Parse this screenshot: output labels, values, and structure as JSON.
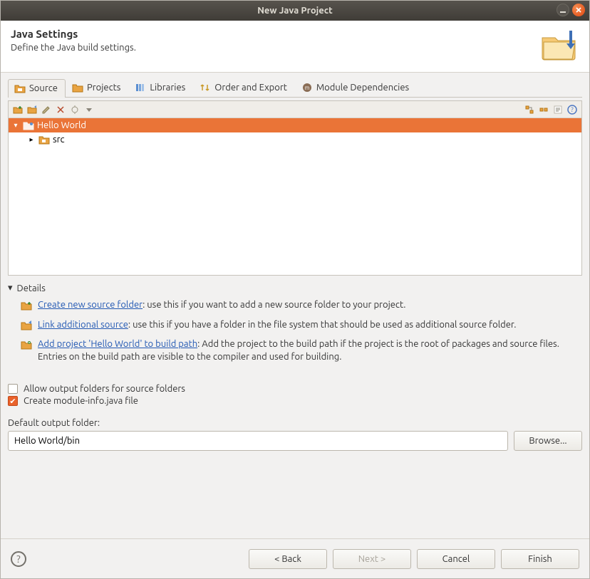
{
  "window": {
    "title": "New Java Project"
  },
  "header": {
    "title": "Java Settings",
    "subtitle": "Define the Java build settings."
  },
  "tabs": [
    {
      "label": "Source"
    },
    {
      "label": "Projects"
    },
    {
      "label": "Libraries"
    },
    {
      "label": "Order and Export"
    },
    {
      "label": "Module Dependencies"
    }
  ],
  "tree": {
    "root": "Hello World",
    "child": "src"
  },
  "details": {
    "heading": "Details",
    "items": [
      {
        "link": "Create new source folder",
        "tail": ": use this if you want to add a new source folder to your project."
      },
      {
        "link": "Link additional source",
        "tail": ": use this if you have a folder in the file system that should be used as additional source folder."
      },
      {
        "link": "Add project 'Hello World' to build path",
        "tail": ": Add the project to the build path if the project is the root of packages and source files. Entries on the build path are visible to the compiler and used for building."
      }
    ]
  },
  "checks": {
    "allow_output": {
      "label": "Allow output folders for source folders",
      "checked": false
    },
    "module_info": {
      "label": "Create module-info.java file",
      "checked": true
    }
  },
  "output": {
    "label": "Default output folder:",
    "value": "Hello World/bin",
    "browse": "Browse..."
  },
  "buttons": {
    "back": "< Back",
    "next": "Next >",
    "cancel": "Cancel",
    "finish": "Finish"
  }
}
